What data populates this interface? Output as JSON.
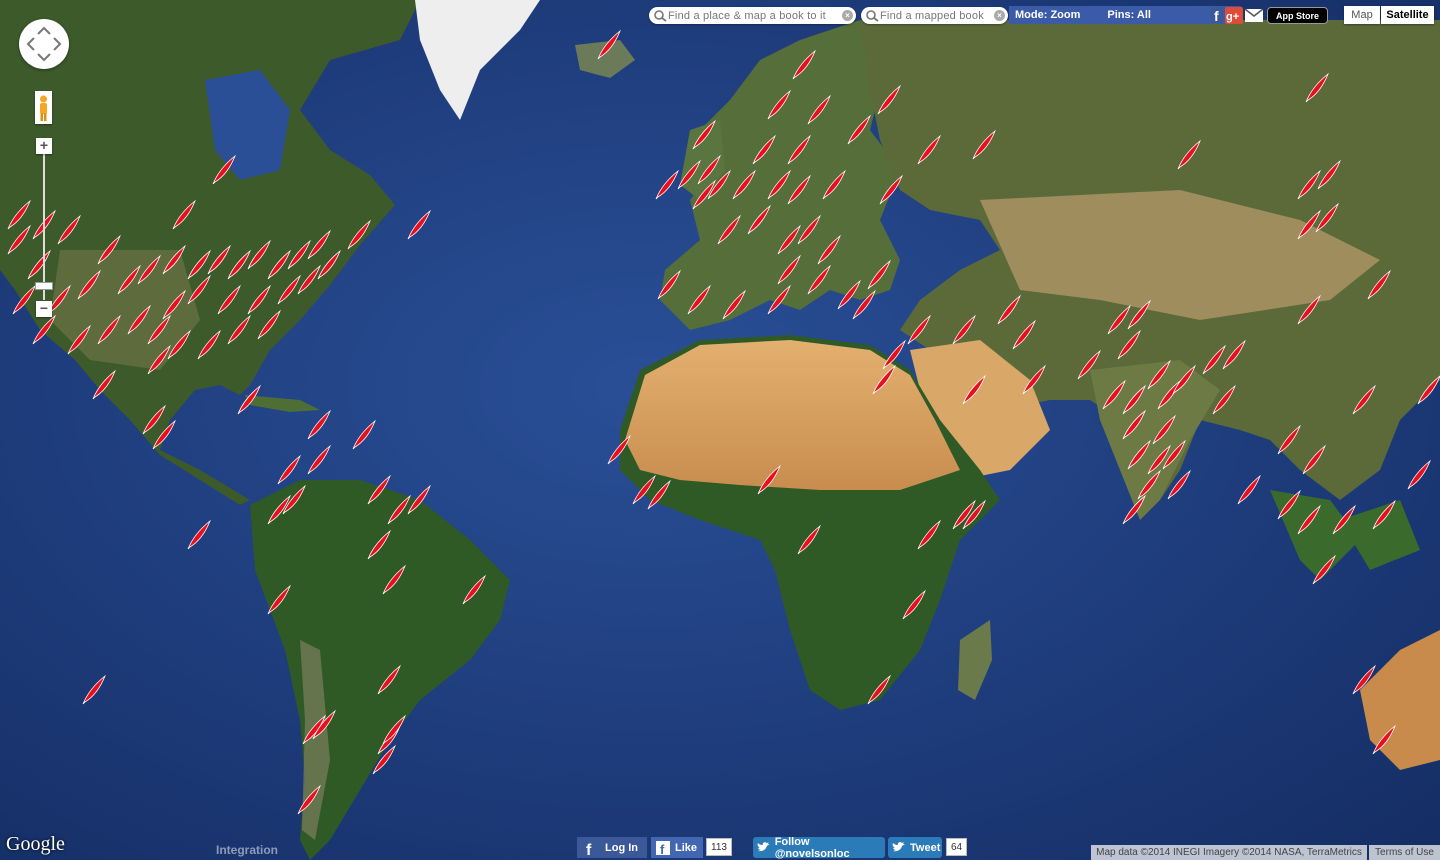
{
  "search": {
    "place_placeholder": "Find a place & map a book to it",
    "book_placeholder": "Find a mapped book"
  },
  "topbar": {
    "mode_label": "Mode: Zoom",
    "pins_label": "Pins: All",
    "app_store_label": "App Store"
  },
  "map_types": {
    "map_label": "Map",
    "satellite_label": "Satellite",
    "selected": "Satellite"
  },
  "map": {
    "type": "satellite world map",
    "pin_icon": "red-quill-icon",
    "pin_color": "#e8101e"
  },
  "footer": {
    "google_logo": "Google",
    "integration_text": "Integration",
    "login_label": "Log In",
    "like_label": "Like",
    "like_count": "113",
    "follow_label": "Follow @novelsonloc",
    "tweet_label": "Tweet",
    "tweet_count": "64",
    "map_data_text": "Map data ©2014 INEGI Imagery ©2014 NASA, TerraMetrics",
    "terms_label": "Terms of Use"
  },
  "colors": {
    "ocean": "#1d3a7e",
    "toolbar_blue": "#3b5ba8",
    "facebook_blue": "#3b5998",
    "twitter_blue": "#2b7bb9"
  }
}
